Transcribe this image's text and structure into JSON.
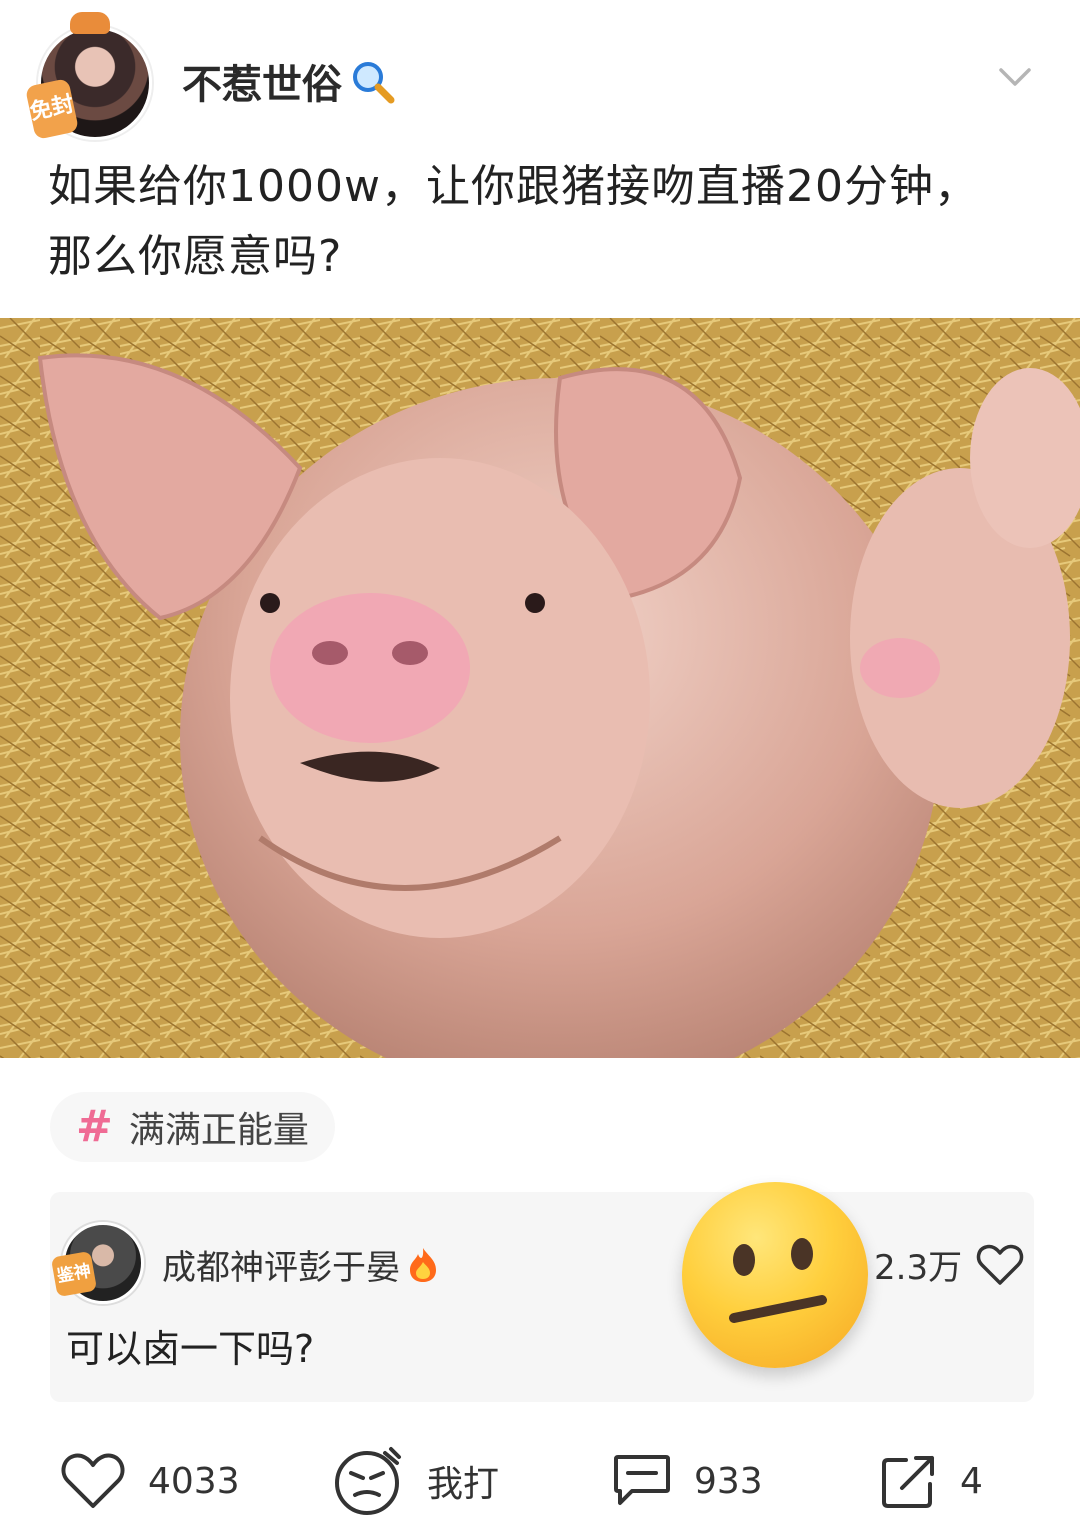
{
  "header": {
    "username": "不惹世俗",
    "avatar_badge": "免封"
  },
  "post": {
    "text_line1": "如果给你1000w，让你跟猪接吻直播20分钟，",
    "text_line2": "那么你愿意吗?"
  },
  "topic": {
    "hash": "#",
    "label": "满满正能量"
  },
  "comment": {
    "author": "成都神评彭于晏",
    "avatar_badge": "鉴神",
    "text": "可以卤一下吗?",
    "likes": "2.3万"
  },
  "actions": {
    "like_count": "4033",
    "hit_label": "我打",
    "comment_count": "933",
    "share_count": "4"
  },
  "icons": {
    "search": "magnifier-icon",
    "fire": "fire-icon",
    "more": "chevron-down-icon"
  },
  "colors": {
    "topic_hash": "#ef6b94",
    "background": "#ffffff",
    "card": "#f6f6f6"
  }
}
